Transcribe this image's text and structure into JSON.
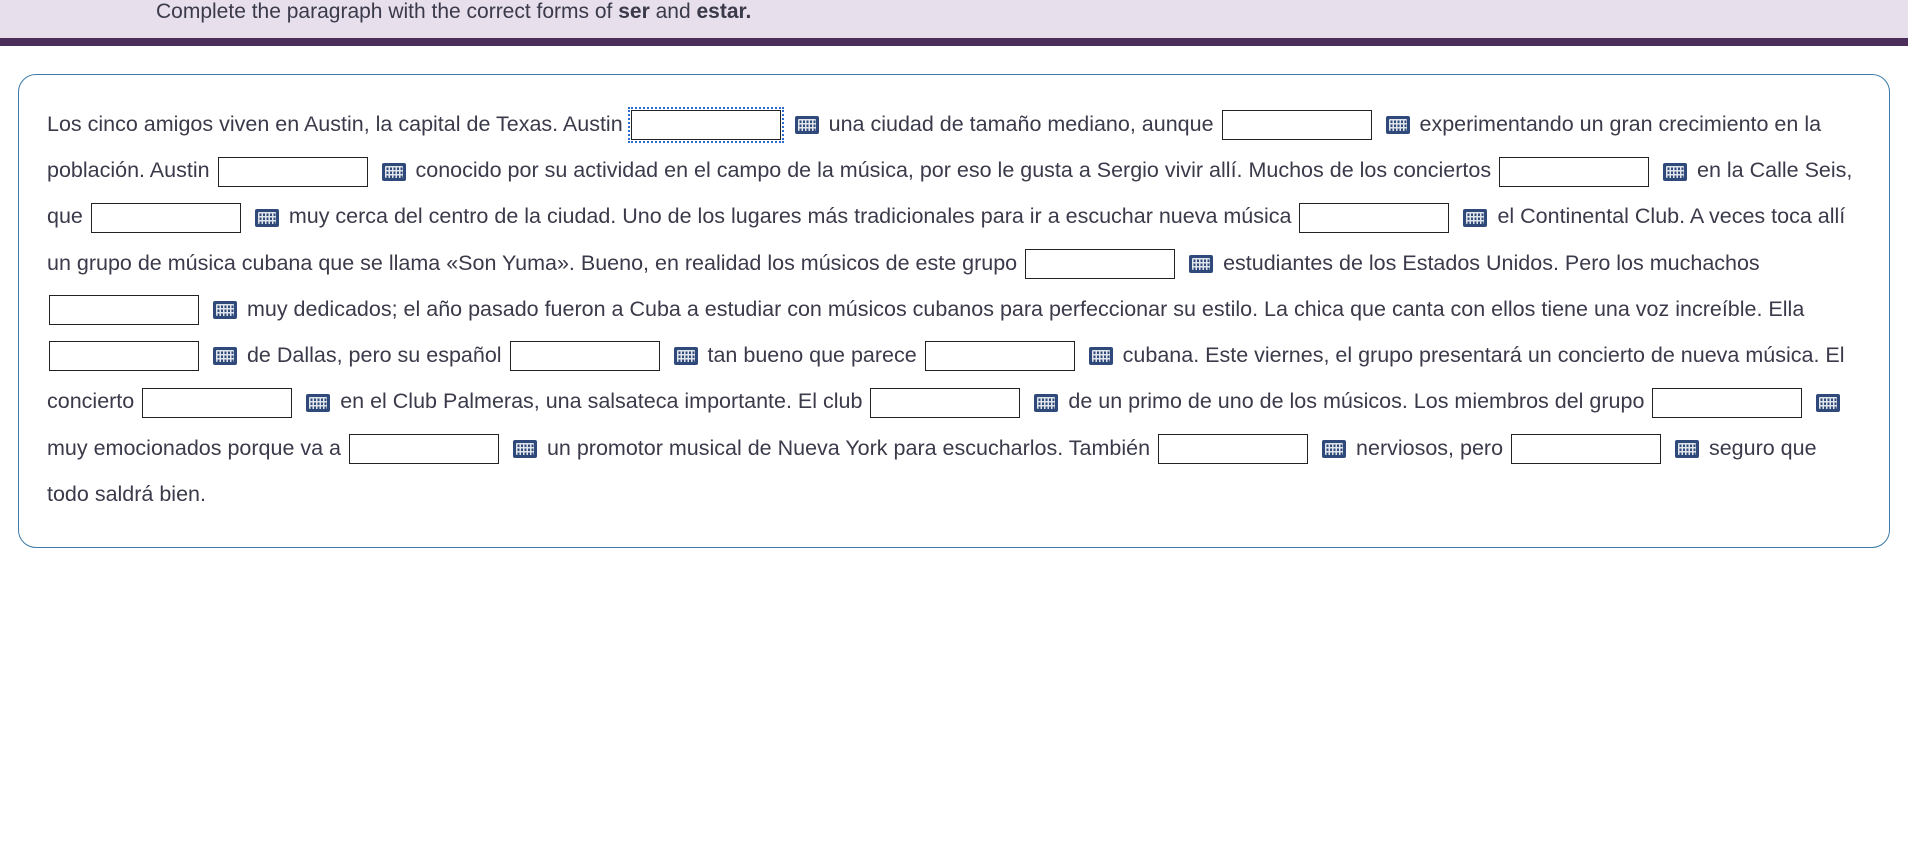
{
  "instructions": {
    "prefix": "Complete the paragraph with the correct forms of ",
    "bold1": "ser",
    "mid": " and ",
    "bold2": "estar.",
    "suffix": ""
  },
  "p": {
    "t1": "Los cinco amigos viven en Austin, la capital de Texas. Austin",
    "t2": " una ciudad de tamaño mediano, aunque ",
    "t3": " experimentando un gran crecimiento en la población. Austin ",
    "t4": " conocido por su actividad en el campo de la música, por eso le gusta a Sergio vivir allí. Muchos de los conciertos ",
    "t5": " en la Calle Seis, que ",
    "t6": " muy cerca del centro de la ciudad. Uno de los lugares más tradicionales para ir a escuchar nueva música ",
    "t7": " el Continental Club. A veces toca allí un grupo de música cubana que se llama «Son Yuma». Bueno, en realidad los músicos de este grupo ",
    "t8": " estudiantes de los Estados Unidos. Pero los muchachos ",
    "t9": " muy dedicados; el año pasado fueron a Cuba a estudiar con músicos cubanos para perfeccionar su estilo. La chica que canta con ellos tiene una voz increíble. Ella ",
    "t10": " de Dallas, pero su español ",
    "t11": " tan bueno que parece ",
    "t12": " cubana. Este viernes, el grupo presentará un concierto de nueva música. El concierto ",
    "t13": " en el Club Palmeras, una salsateca importante. El club ",
    "t14": " de un primo de uno de los músicos. Los miembros del grupo ",
    "t15": " muy emocionados porque va a ",
    "t16": " un promotor musical de Nueva York para escucharlos. También ",
    "t17": " nerviosos, pero ",
    "t18": " seguro que todo saldrá bien."
  }
}
